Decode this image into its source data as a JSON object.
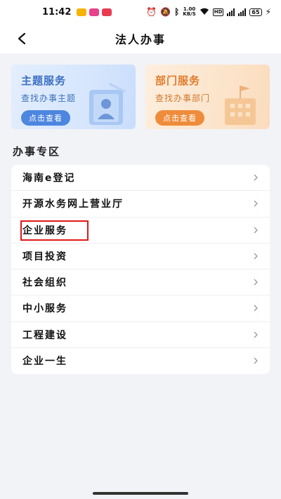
{
  "status_bar": {
    "time": "11:42",
    "net_speed_value": "1.00",
    "net_speed_unit": "KB/S",
    "hd_label": "HD",
    "battery": "65"
  },
  "header": {
    "title": "法人办事"
  },
  "cards": [
    {
      "title": "主题服务",
      "subtitle": "查找办事主题",
      "button": "点击查看"
    },
    {
      "title": "部门服务",
      "subtitle": "查找办事部门",
      "button": "点击查看"
    }
  ],
  "section": {
    "title": "办事专区"
  },
  "list": {
    "items": [
      {
        "label": "海南e登记"
      },
      {
        "label": "开源水务网上营业厅"
      },
      {
        "label": "企业服务"
      },
      {
        "label": "项目投资"
      },
      {
        "label": "社会组织"
      },
      {
        "label": "中小服务"
      },
      {
        "label": "工程建设"
      },
      {
        "label": "企业一生"
      }
    ]
  },
  "colors": {
    "accent_blue": "#4c86df",
    "accent_orange": "#ef8c3c",
    "highlight_red": "#e01818",
    "page_bg": "#f2f3f7"
  }
}
